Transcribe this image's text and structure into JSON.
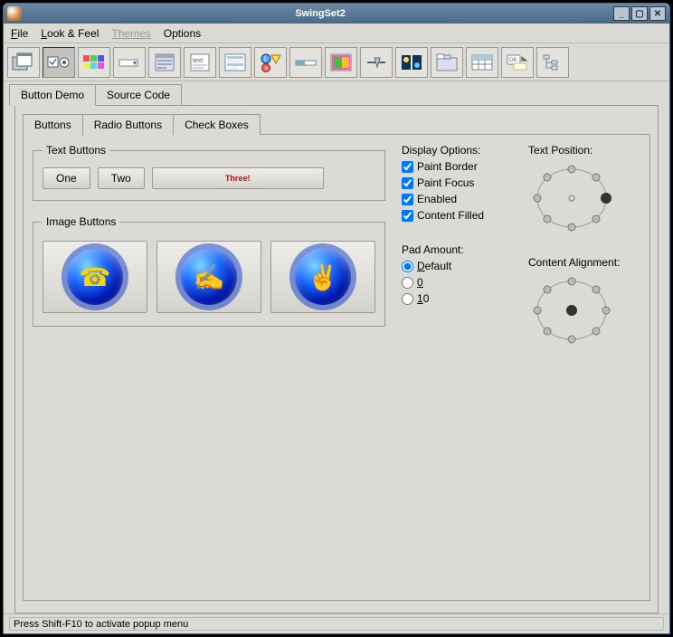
{
  "window": {
    "title": "SwingSet2"
  },
  "menubar": {
    "file": "File",
    "look": "Look & Feel",
    "themes": "Themes",
    "options": "Options"
  },
  "tabs": {
    "demo": "Button Demo",
    "source": "Source Code"
  },
  "innerTabs": {
    "buttons": "Buttons",
    "radio": "Radio Buttons",
    "check": "Check Boxes"
  },
  "textButtons": {
    "legend": "Text Buttons",
    "one": "One",
    "two": "Two",
    "three": "Three!"
  },
  "imageButtons": {
    "legend": "Image Buttons"
  },
  "displayOptions": {
    "head": "Display Options:",
    "paintBorder": "Paint Border",
    "paintFocus": "Paint Focus",
    "enabled": "Enabled",
    "contentFilled": "Content Filled"
  },
  "padAmount": {
    "head": "Pad Amount:",
    "default": "Default",
    "zero": "0",
    "ten": "10"
  },
  "textPosition": {
    "head": "Text Position:"
  },
  "contentAlignment": {
    "head": "Content Alignment:"
  },
  "status": "Press Shift-F10 to activate popup menu"
}
